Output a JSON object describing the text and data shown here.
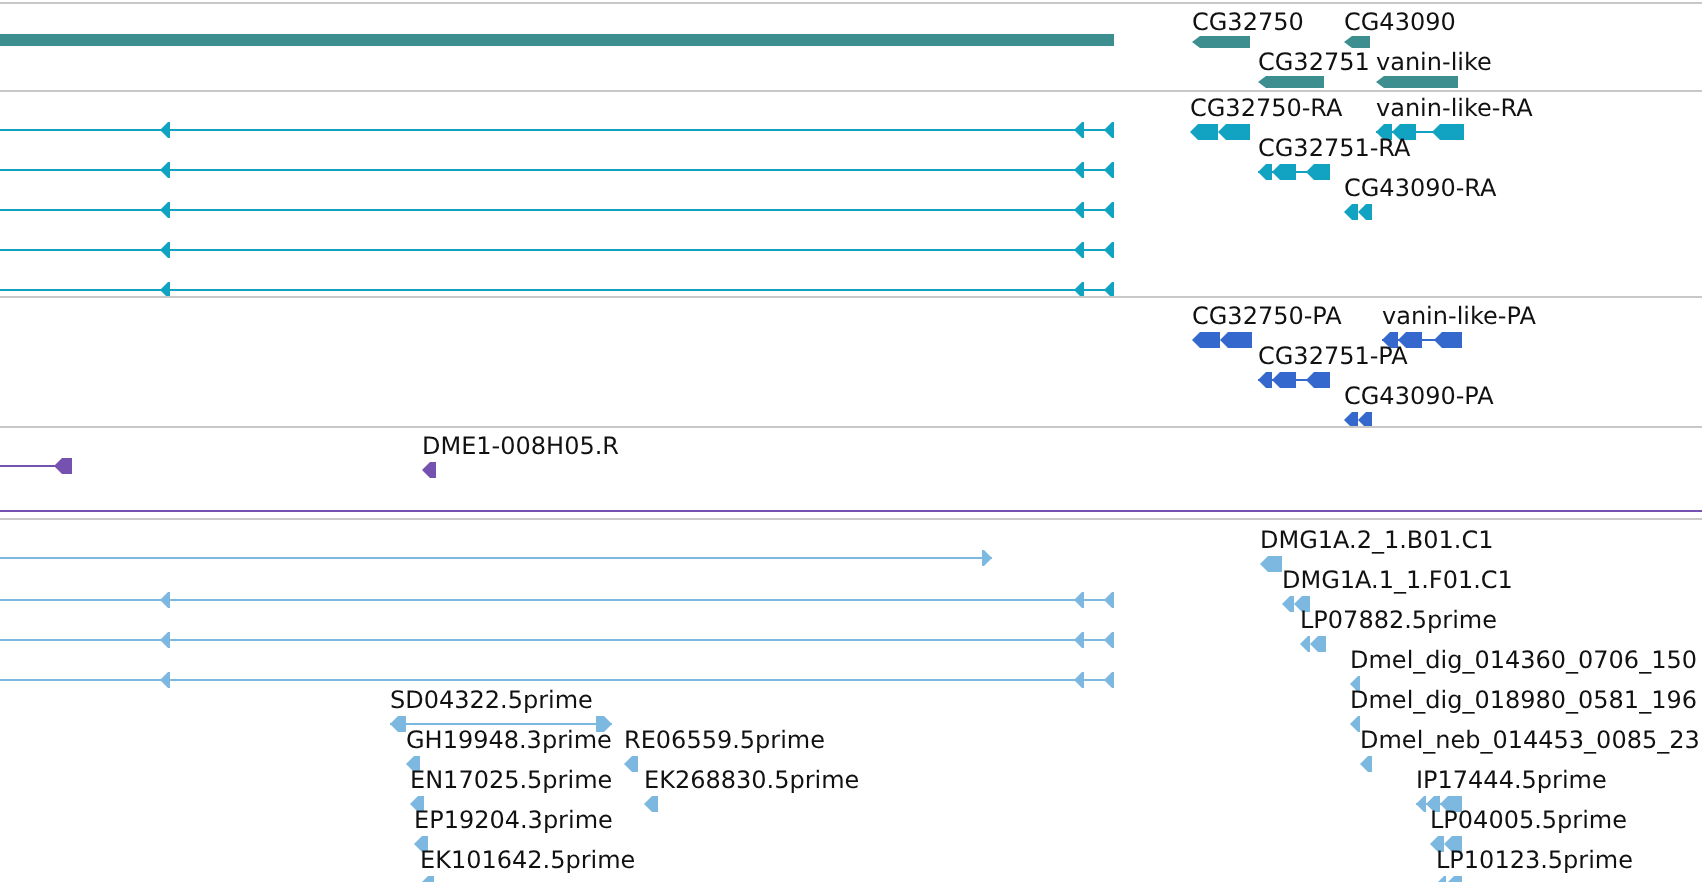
{
  "tracks": [
    {
      "kind": "gene",
      "color": "#3d8f8f",
      "features": [
        {
          "label": "CG32750"
        },
        {
          "label": "CG43090"
        },
        {
          "label": "CG32751"
        },
        {
          "label": "vanin-like"
        }
      ]
    },
    {
      "kind": "transcript",
      "color": "#12a2c2",
      "features": [
        {
          "label": "CG32750-RA"
        },
        {
          "label": "vanin-like-RA"
        },
        {
          "label": "CG32751-RA"
        },
        {
          "label": "CG43090-RA"
        }
      ]
    },
    {
      "kind": "protein",
      "color": "#3468cc",
      "features": [
        {
          "label": "CG32750-PA"
        },
        {
          "label": "vanin-like-PA"
        },
        {
          "label": "CG32751-PA"
        },
        {
          "label": "CG43090-PA"
        }
      ]
    },
    {
      "kind": "clone",
      "color": "#7552b0",
      "features": [
        {
          "label": "DME1-008H05.R"
        }
      ]
    },
    {
      "kind": "est",
      "color": "#7db8e0",
      "features": [
        {
          "label": "DMG1A.2_1.B01.C1"
        },
        {
          "label": "DMG1A.1_1.F01.C1"
        },
        {
          "label": "LP07882.5prime"
        },
        {
          "label": "Dmel_dig_014360_0706_150"
        },
        {
          "label": "SD04322.5prime"
        },
        {
          "label": "Dmel_dig_018980_0581_196"
        },
        {
          "label": "GH19948.3prime"
        },
        {
          "label": "RE06559.5prime"
        },
        {
          "label": "Dmel_neb_014453_0085_23"
        },
        {
          "label": "EN17025.5prime"
        },
        {
          "label": "EK268830.5prime"
        },
        {
          "label": "IP17444.5prime"
        },
        {
          "label": "EP19204.3prime"
        },
        {
          "label": "LP04005.5prime"
        },
        {
          "label": "EK101642.5prime"
        },
        {
          "label": "LP10123.5prime"
        }
      ]
    }
  ]
}
